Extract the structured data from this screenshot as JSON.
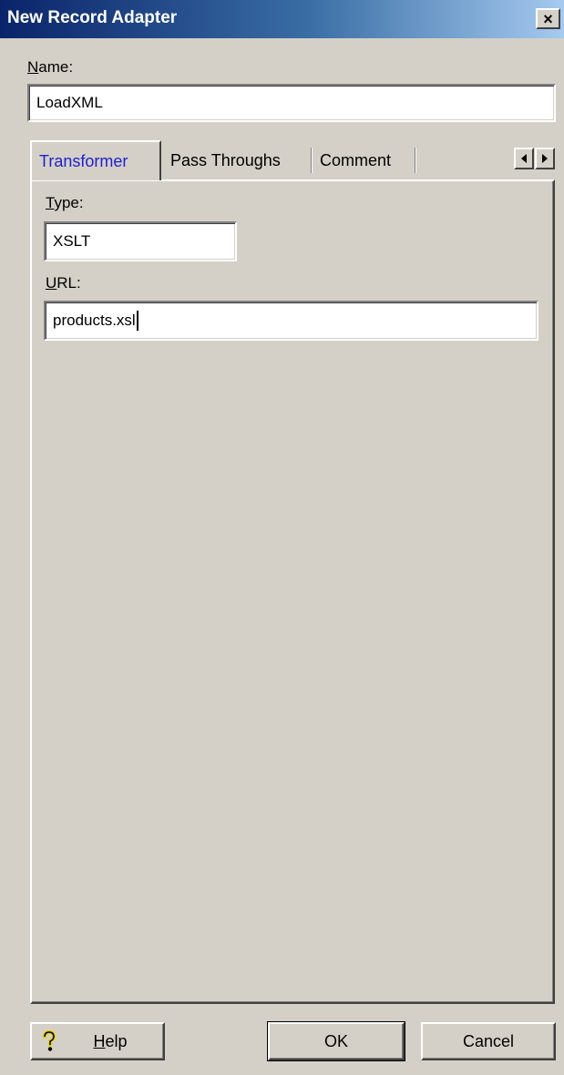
{
  "window": {
    "title": "New Record Adapter",
    "close_symbol": "×"
  },
  "name_field": {
    "label_first": "N",
    "label_rest": "ame:",
    "value": "LoadXML"
  },
  "tabs": [
    {
      "label": "Transformer",
      "active": true
    },
    {
      "label": "Pass Throughs",
      "active": false
    },
    {
      "label": "Comment",
      "active": false
    }
  ],
  "tab_scroll": {
    "left_icon": "triangle-left-icon",
    "right_icon": "triangle-right-icon"
  },
  "transformer": {
    "type_label_first": "T",
    "type_label_rest": "ype:",
    "type_value": "XSLT",
    "url_label_first": "U",
    "url_label_rest": "RL:",
    "url_value": "products.xsl"
  },
  "buttons": {
    "help_icon": "question-mark-icon",
    "help_label_first": "H",
    "help_label_rest": "elp",
    "ok_label": "OK",
    "cancel_label": "Cancel"
  }
}
